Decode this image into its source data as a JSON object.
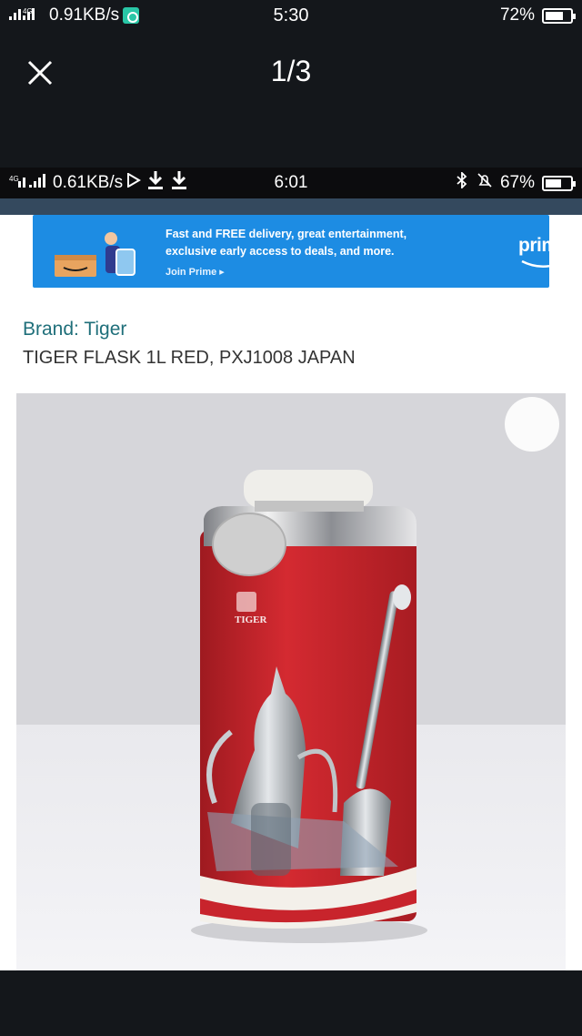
{
  "outer_status": {
    "network_speed": "0.91KB/s",
    "time": "5:30",
    "battery_percent": "72%",
    "battery_level": 0.72
  },
  "viewer": {
    "page_counter": "1/3"
  },
  "inner_status": {
    "network_speed": "0.61KB/s",
    "time": "6:01",
    "battery_percent": "67%",
    "battery_level": 0.67
  },
  "banner": {
    "line1": "Fast and FREE delivery, great entertainment,",
    "line2": "exclusive early access to deals, and more.",
    "link": "Join Prime ▸",
    "logo": "prime",
    "color": "#1d8ce3"
  },
  "product": {
    "brand": "Brand: Tiger",
    "title": "TIGER FLASK 1L RED, PXJ1008 JAPAN",
    "logo_text": "TIGER",
    "body_color": "#c8242c"
  }
}
